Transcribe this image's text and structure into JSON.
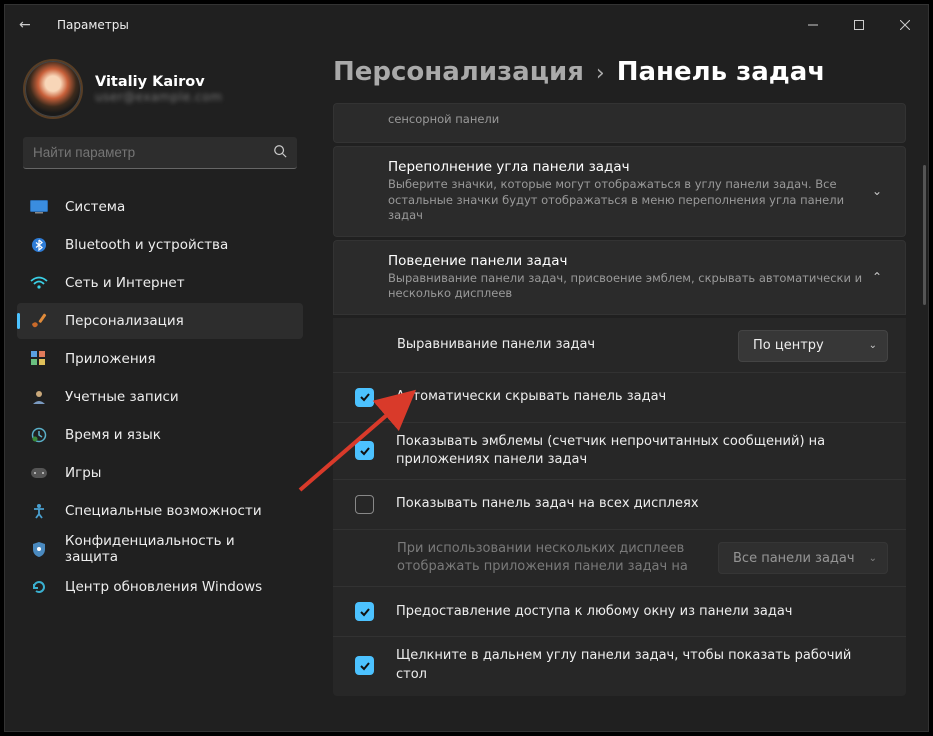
{
  "window": {
    "title": "Параметры"
  },
  "user": {
    "name": "Vitaliy Kairov",
    "email": "—"
  },
  "search": {
    "placeholder": "Найти параметр"
  },
  "nav": [
    {
      "id": "system",
      "label": "Система"
    },
    {
      "id": "bluetooth",
      "label": "Bluetooth и устройства"
    },
    {
      "id": "network",
      "label": "Сеть и Интернет"
    },
    {
      "id": "personalization",
      "label": "Персонализация",
      "active": true
    },
    {
      "id": "apps",
      "label": "Приложения"
    },
    {
      "id": "accounts",
      "label": "Учетные записи"
    },
    {
      "id": "time",
      "label": "Время и язык"
    },
    {
      "id": "gaming",
      "label": "Игры"
    },
    {
      "id": "access",
      "label": "Специальные возможности"
    },
    {
      "id": "privacy",
      "label": "Конфиденциальность и защита"
    },
    {
      "id": "update",
      "label": "Центр обновления Windows"
    }
  ],
  "breadcrumb": {
    "parent": "Персонализация",
    "current": "Панель задач"
  },
  "cards": {
    "truncated_sub": "сенсорной панели",
    "overflow": {
      "title": "Переполнение угла панели задач",
      "sub": "Выберите значки, которые могут отображаться в углу панели задач. Все остальные значки будут отображаться в меню переполнения угла панели задач"
    },
    "behavior": {
      "title": "Поведение панели задач",
      "sub": "Выравнивание панели задач, присвоение эмблем, скрывать автоматически и несколько дисплеев"
    }
  },
  "behavior_rows": {
    "alignment": {
      "label": "Выравнивание панели задач",
      "value": "По центру"
    },
    "autohide": {
      "label": "Автоматически скрывать панель задач",
      "checked": true
    },
    "badges": {
      "label": "Показывать эмблемы (счетчик непрочитанных сообщений) на приложениях панели задач",
      "checked": true
    },
    "all_displays": {
      "label": "Показывать панель задач на всех дисплеях",
      "checked": false
    },
    "multi": {
      "label": "При использовании нескольких дисплеев отображать приложения панели задач на",
      "value": "Все панели задач"
    },
    "flash": {
      "label": "Предоставление доступа к любому окну из панели задач",
      "checked": true
    },
    "corner": {
      "label": "Щелкните в дальнем углу панели задач, чтобы показать рабочий стол",
      "checked": true
    }
  }
}
